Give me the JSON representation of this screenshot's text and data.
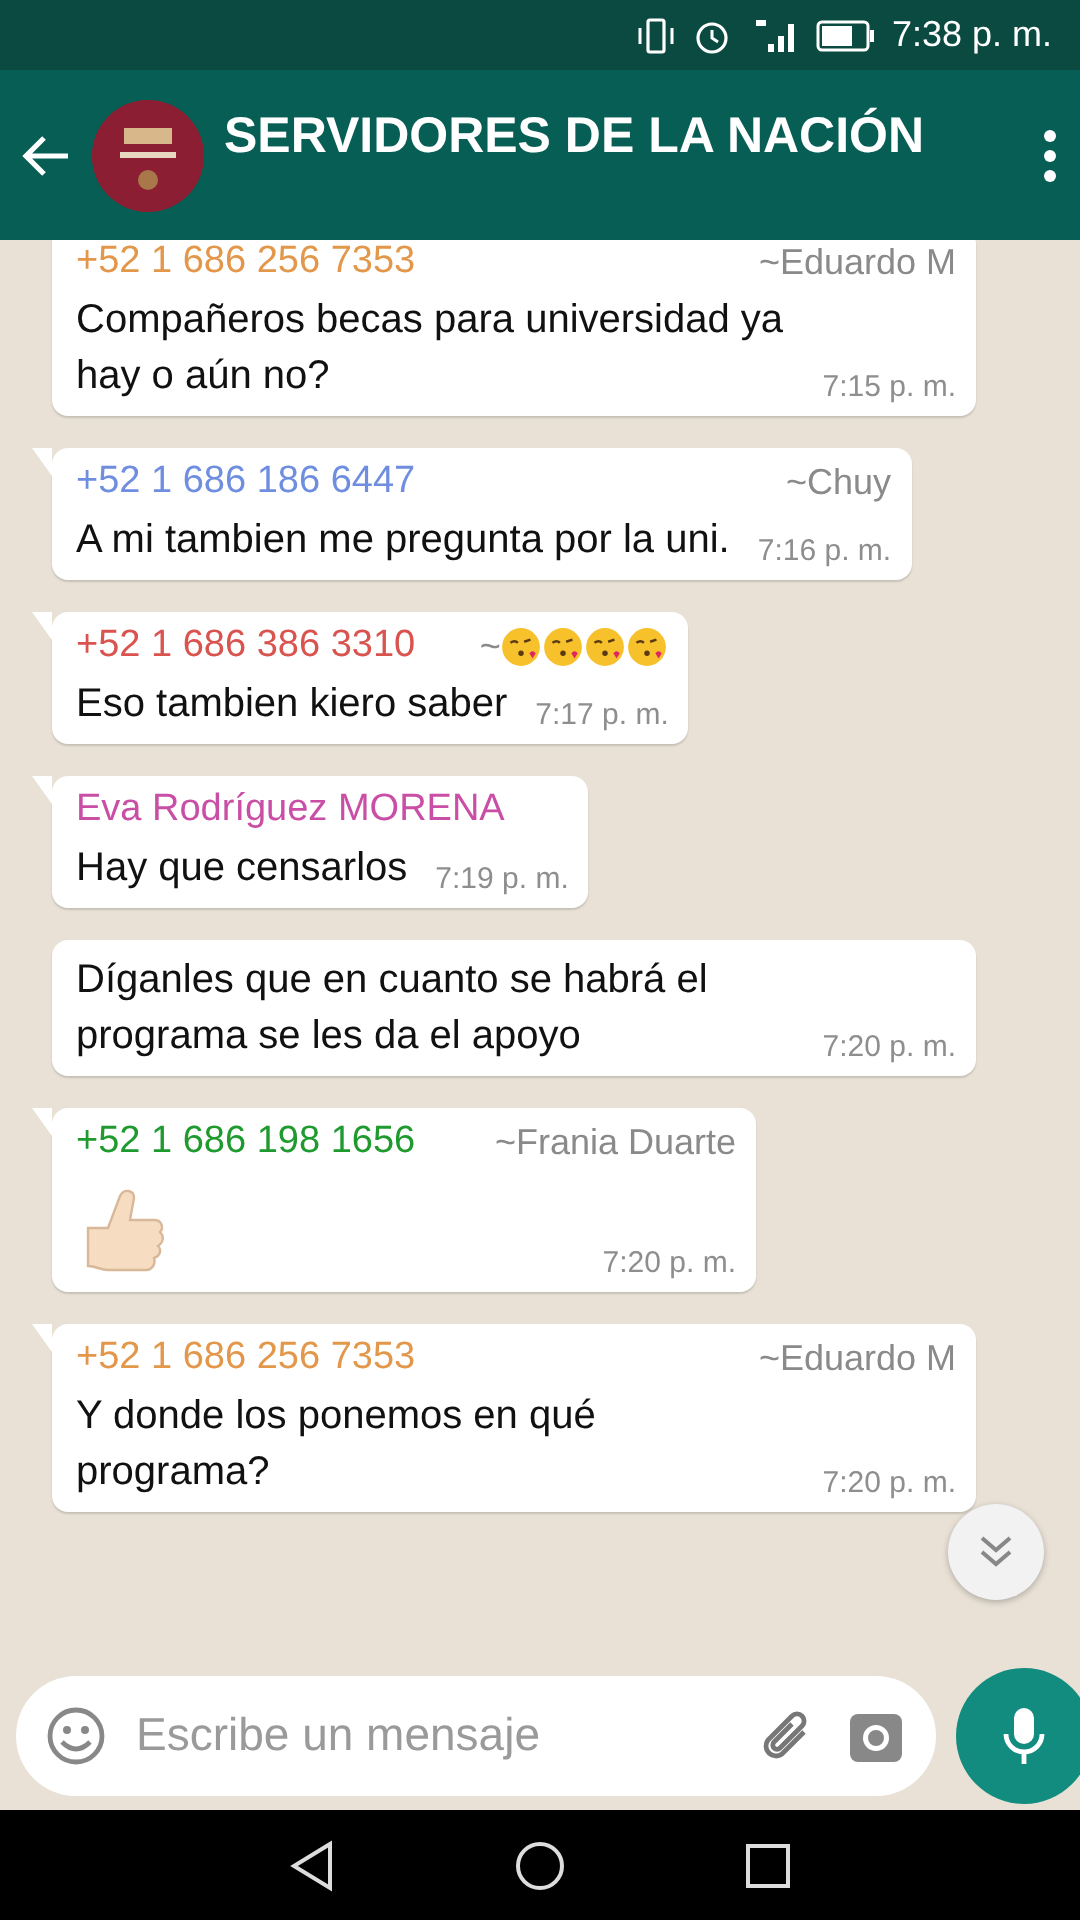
{
  "status_bar": {
    "time": "7:38 p. m."
  },
  "header": {
    "title": "SERVIDORES DE LA NACIÓN"
  },
  "messages": [
    {
      "sender": "+52 1 686 256 7353",
      "color": "#e2974a",
      "push_name": "~Eduardo M",
      "text": "Compañeros becas para universidad ya hay o aún no?",
      "time": "7:15 p. m.",
      "kind": "text",
      "tail": false
    },
    {
      "sender": "+52 1 686 186 6447",
      "color": "#6f8ee0",
      "push_name": "~Chuy",
      "text": "A mi tambien me pregunta por la uni.",
      "time": "7:16 p. m.",
      "kind": "text",
      "tail": true
    },
    {
      "sender": "+52 1 686 386 3310",
      "color": "#d9534f",
      "push_name": "~",
      "push_icons": [
        {
          "kind": "kiss-face"
        },
        {
          "kind": "kiss-face"
        },
        {
          "kind": "kiss-face"
        },
        {
          "kind": "kiss-face"
        }
      ],
      "text": "Eso tambien kiero saber",
      "time": "7:17 p. m.",
      "kind": "text",
      "tail": true
    },
    {
      "sender": "Eva Rodríguez MORENA",
      "color": "#c94fa6",
      "text": "Hay que censarlos",
      "time": "7:19 p. m.",
      "kind": "text",
      "tail": true
    },
    {
      "text": "Díganles que en cuanto se habrá el programa se les da el apoyo",
      "time": "7:20 p. m.",
      "kind": "text",
      "tail": false
    },
    {
      "sender": "+52 1 686 198 1656",
      "color": "#1f9a2e",
      "push_name": "~Frania Duarte",
      "time": "7:20 p. m.",
      "kind": "thumbs-up",
      "tail": true
    },
    {
      "sender": "+52 1 686 256 7353",
      "color": "#e2974a",
      "push_name": "~Eduardo M",
      "text": "Y donde los ponemos en qué programa?",
      "time": "7:20 p. m.",
      "kind": "text",
      "tail": true
    }
  ],
  "composer": {
    "placeholder": "Escribe un mensaje"
  }
}
